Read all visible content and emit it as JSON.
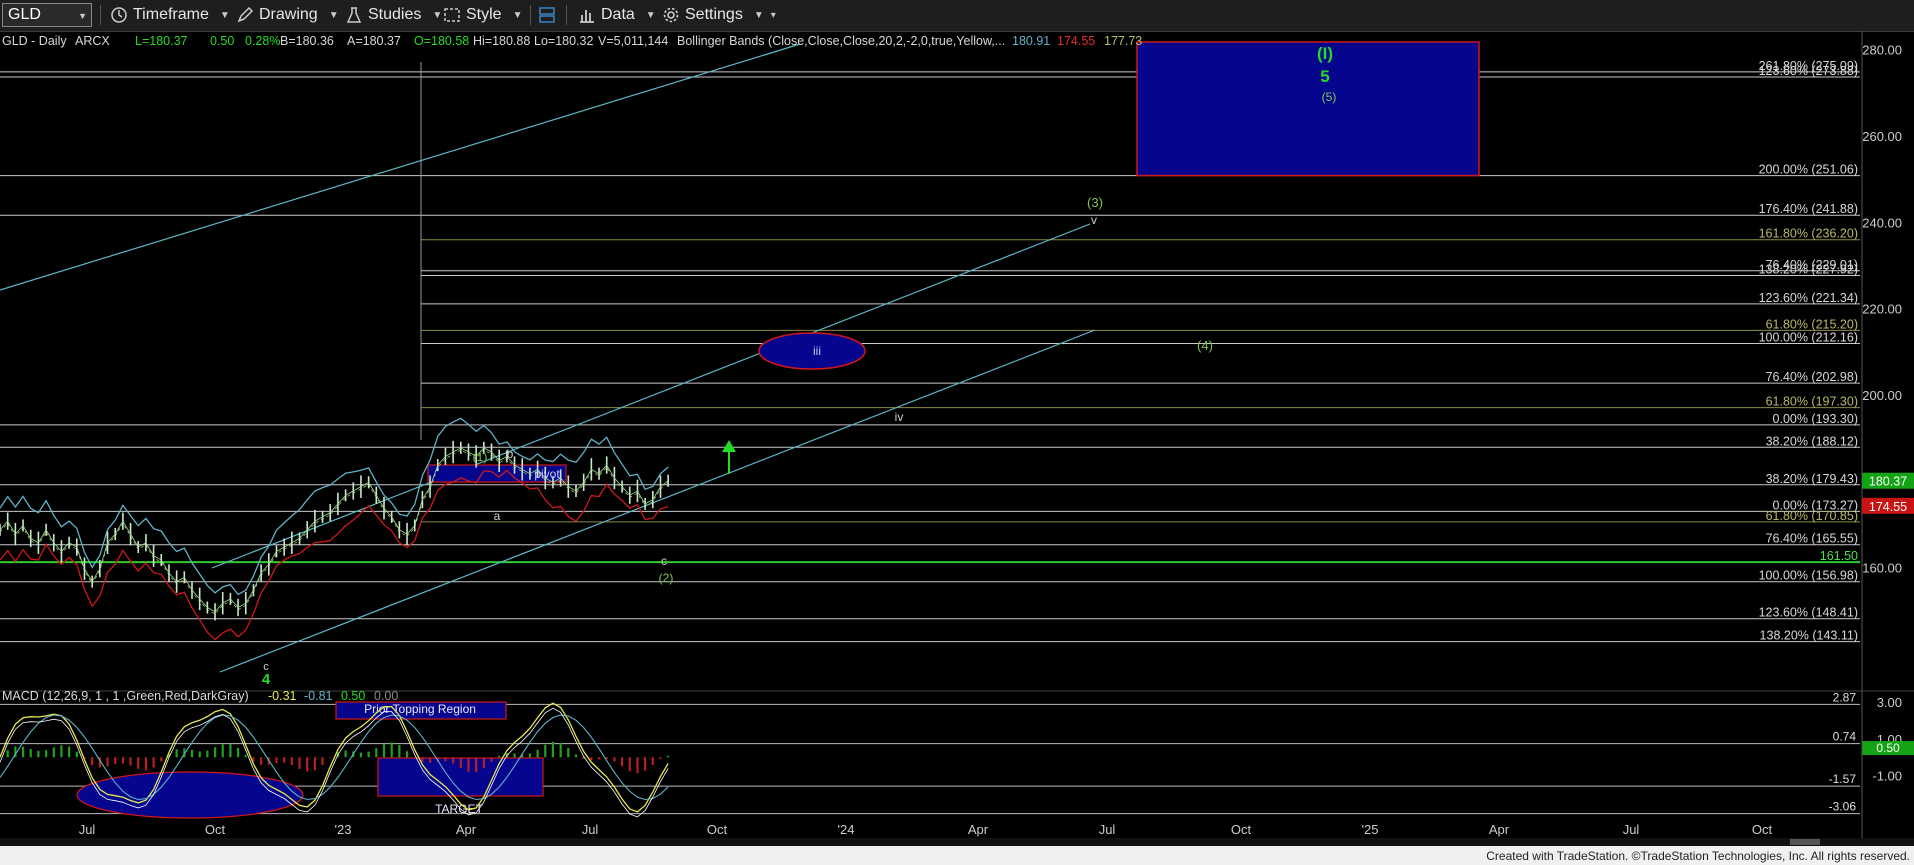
{
  "toolbar": {
    "symbol": "GLD",
    "timeframe": "Timeframe",
    "drawing": "Drawing",
    "studies": "Studies",
    "style": "Style",
    "data": "Data",
    "settings": "Settings"
  },
  "header": {
    "title": "GLD - Daily",
    "exchange": "ARCX",
    "last": "L=180.37",
    "change": "0.50",
    "change_pct": "0.28%",
    "bid": "B=180.36",
    "ask": "A=180.37",
    "open": "O=180.58",
    "high": "Hi=180.88",
    "low": "Lo=180.32",
    "volume": "V=5,011,144",
    "bb_label": "Bollinger Bands (Close,Close,Close,20,2,-2,0,true,Yellow,...",
    "bb_val1": "180.91",
    "bb_val2": "174.55",
    "bb_val3": "177.73"
  },
  "macd_header": {
    "label": "MACD (12,26,9, 1 , 1 ,Green,Red,DarkGray)",
    "v1": "-0.31",
    "v2": "-0.81",
    "v3": "0.50",
    "v4": "0.00"
  },
  "footer": {
    "copyright": "Created with TradeStation. ©TradeStation Technologies, Inc. All rights reserved."
  },
  "colors": {
    "background": "#000000",
    "price_line": "#ffffff",
    "bb_upper": "#5fb3c8",
    "bb_lower": "#d01818",
    "bb_mid": "#bbbb66",
    "macd_line": "#e8e84a",
    "signal_line": "#ffffff",
    "hist_pos": "#1fa31f",
    "hist_neg": "#b82020",
    "channel": "#5ab8c8",
    "fib_line": "#c9c9c9",
    "fib_olive": "#8c8c3c",
    "wave_green": "#7ec850",
    "target_box": "#05058e",
    "target_border": "#d01818"
  },
  "chart_data": [
    {
      "type": "line",
      "title": "GLD - Daily",
      "ylim": [
        140,
        282
      ],
      "x_ticks": [
        "Jul",
        "Oct",
        "'23",
        "Apr",
        "Jul",
        "Oct",
        "'24",
        "Apr",
        "Jul",
        "Oct",
        "'25",
        "Apr",
        "Jul",
        "Oct"
      ],
      "y_ticks": [
        160.0,
        180.0,
        200.0,
        220.0,
        240.0,
        260.0,
        280.0
      ],
      "series": [
        {
          "name": "GLD",
          "points": [
            [
              0,
              169
            ],
            [
              8,
              171
            ],
            [
              16,
              168
            ],
            [
              24,
              170
            ],
            [
              32,
              167
            ],
            [
              40,
              166
            ],
            [
              48,
              169
            ],
            [
              56,
              166
            ],
            [
              64,
              164
            ],
            [
              72,
              166
            ],
            [
              80,
              165
            ],
            [
              88,
              160
            ],
            [
              96,
              157
            ],
            [
              104,
              160
            ],
            [
              112,
              166
            ],
            [
              120,
              168
            ],
            [
              128,
              171
            ],
            [
              136,
              168
            ],
            [
              144,
              165
            ],
            [
              152,
              166
            ],
            [
              160,
              163
            ],
            [
              168,
              162
            ],
            [
              176,
              159
            ],
            [
              184,
              157
            ],
            [
              192,
              158
            ],
            [
              200,
              155
            ],
            [
              208,
              153
            ],
            [
              216,
              151
            ],
            [
              224,
              150
            ],
            [
              232,
              152
            ],
            [
              240,
              153
            ],
            [
              248,
              151
            ],
            [
              256,
              152
            ],
            [
              264,
              155
            ],
            [
              272,
              159
            ],
            [
              280,
              161
            ],
            [
              288,
              164
            ],
            [
              296,
              165
            ],
            [
              304,
              166
            ],
            [
              312,
              167
            ],
            [
              320,
              169
            ],
            [
              328,
              171
            ],
            [
              336,
              172
            ],
            [
              344,
              173
            ],
            [
              352,
              175
            ],
            [
              360,
              177
            ],
            [
              368,
              178
            ],
            [
              376,
              179
            ],
            [
              384,
              180
            ],
            [
              392,
              177
            ],
            [
              400,
              174
            ],
            [
              408,
              172
            ],
            [
              416,
              169
            ],
            [
              424,
              168
            ],
            [
              432,
              170
            ],
            [
              440,
              176
            ],
            [
              448,
              179
            ],
            [
              456,
              184
            ],
            [
              464,
              186
            ],
            [
              472,
              187
            ],
            [
              480,
              188
            ],
            [
              488,
              187
            ],
            [
              496,
              186
            ],
            [
              504,
              188
            ],
            [
              512,
              187
            ],
            [
              520,
              185
            ],
            [
              528,
              186
            ],
            [
              536,
              184
            ],
            [
              544,
              183
            ],
            [
              552,
              182
            ],
            [
              560,
              183
            ],
            [
              568,
              181
            ],
            [
              576,
              180
            ],
            [
              584,
              181
            ],
            [
              592,
              179
            ],
            [
              600,
              178
            ],
            [
              608,
              180
            ],
            [
              616,
              183
            ],
            [
              624,
              182
            ],
            [
              632,
              184
            ],
            [
              640,
              181
            ],
            [
              648,
              179
            ],
            [
              656,
              177
            ],
            [
              664,
              178
            ],
            [
              672,
              175
            ],
            [
              680,
              176
            ],
            [
              688,
              179
            ],
            [
              696,
              180.37
            ]
          ]
        }
      ],
      "fib_levels": [
        {
          "label": "261.80% (275.09)",
          "y": 275.09
        },
        {
          "label": "123.60% (273.88)",
          "y": 273.88
        },
        {
          "label": "200.00% (251.06)",
          "y": 251.06
        },
        {
          "label": "176.40% (241.88)",
          "y": 241.88
        },
        {
          "label": "161.80% (236.20)",
          "y": 236.2
        },
        {
          "label": "76.40% (229.01)",
          "y": 229.01
        },
        {
          "label": "138.20% (227.92)",
          "y": 227.92
        },
        {
          "label": "123.60% (221.34)",
          "y": 221.34
        },
        {
          "label": "61.80% (215.20)",
          "y": 215.2
        },
        {
          "label": "100.00% (212.16)",
          "y": 212.16
        },
        {
          "label": "76.40% (202.98)",
          "y": 202.98
        },
        {
          "label": "61.80% (197.30)",
          "y": 197.3
        },
        {
          "label": "0.00% (193.30)",
          "y": 193.3
        },
        {
          "label": "38.20% (188.12)",
          "y": 188.12
        },
        {
          "label": "38.20% (179.43)",
          "y": 179.43
        },
        {
          "label": "0.00% (173.27)",
          "y": 173.27
        },
        {
          "label": "61.80% (170.85)",
          "y": 170.85
        },
        {
          "label": "76.40% (165.55)",
          "y": 165.55
        },
        {
          "label": "161.50",
          "y": 161.5
        },
        {
          "label": "100.00% (156.98)",
          "y": 156.98
        },
        {
          "label": "123.60% (148.41)",
          "y": 148.41
        },
        {
          "label": "138.20% (143.11)",
          "y": 143.11
        }
      ],
      "price_tags": [
        {
          "label": "180.37",
          "y": 180.37
        },
        {
          "label": "174.55",
          "y": 174.55
        }
      ],
      "annotations": [
        {
          "text": "(1)"
        },
        {
          "text": "b"
        },
        {
          "text": "a"
        },
        {
          "text": "pivot"
        },
        {
          "text": "c"
        },
        {
          "text": "(2)"
        },
        {
          "text": "iii"
        },
        {
          "text": "iv"
        },
        {
          "text": "(3)"
        },
        {
          "text": "v"
        },
        {
          "text": "(4)"
        },
        {
          "text": "(I)"
        },
        {
          "text": "5"
        },
        {
          "text": "(5)"
        },
        {
          "text": "4"
        },
        {
          "text": "c"
        }
      ]
    },
    {
      "type": "line",
      "title": "MACD (12,26,9, 1 , 1 ,Green,Red,DarkGray)",
      "y_ticks": [
        3.0,
        1.0,
        -1.0
      ],
      "levels": [
        {
          "label": "2.87",
          "y": 2.87
        },
        {
          "label": "0.74",
          "y": 0.74
        },
        {
          "label": "0.50",
          "y": 0.5
        },
        {
          "label": "-1.57",
          "y": -1.57
        },
        {
          "label": "-3.06",
          "y": -3.06
        }
      ],
      "annotations": [
        {
          "text": "Prior Topping Region"
        },
        {
          "text": "TARGET"
        }
      ]
    }
  ]
}
